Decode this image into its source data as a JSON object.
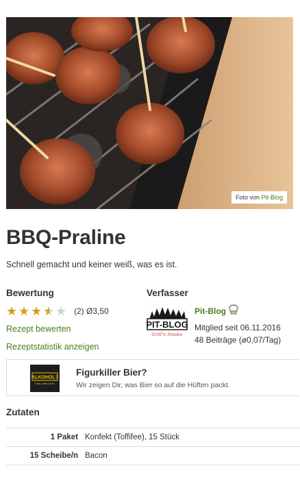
{
  "hero": {
    "photo_credit_prefix": "Foto von",
    "photo_credit_author": "Pit-Blog"
  },
  "recipe": {
    "title": "BBQ-Praline",
    "subtitle": "Schnell gemacht und keiner weiß, was es ist."
  },
  "rating": {
    "heading": "Bewertung",
    "stars_value": 3.5,
    "stars_max": 5,
    "text": "(2) Ø3,50",
    "rate_link": "Rezept bewerten",
    "stats_link": "Rezeptstatistik anzeigen"
  },
  "author": {
    "heading": "Verfasser",
    "name": "Pit-Blog",
    "logo_text": "PIT-BLOG",
    "logo_tagline": "Grill'n Smoke",
    "member_since": "Mitglied seit 06.11.2016",
    "posts": "48 Beiträge (ø0,07/Tag)",
    "icon": "chef-hat-icon"
  },
  "ad": {
    "title": "Figurkiller Bier?",
    "subtitle": "Wir zeigen Dir, was Bier so auf die Hüften packt.",
    "logo_text": "ALKOHOL?",
    "logo_tagline": "Kenn dein Limit."
  },
  "ingredients": {
    "heading": "Zutaten",
    "rows": [
      {
        "amount": "1 Paket",
        "item": "Konfekt (Toffifee), 15 Stück"
      },
      {
        "amount": "15 Scheibe/n",
        "item": "Bacon"
      }
    ]
  },
  "colors": {
    "accent_green": "#4a7d1b",
    "star_gold": "#d4a017",
    "star_empty": "#d0d0d0"
  }
}
